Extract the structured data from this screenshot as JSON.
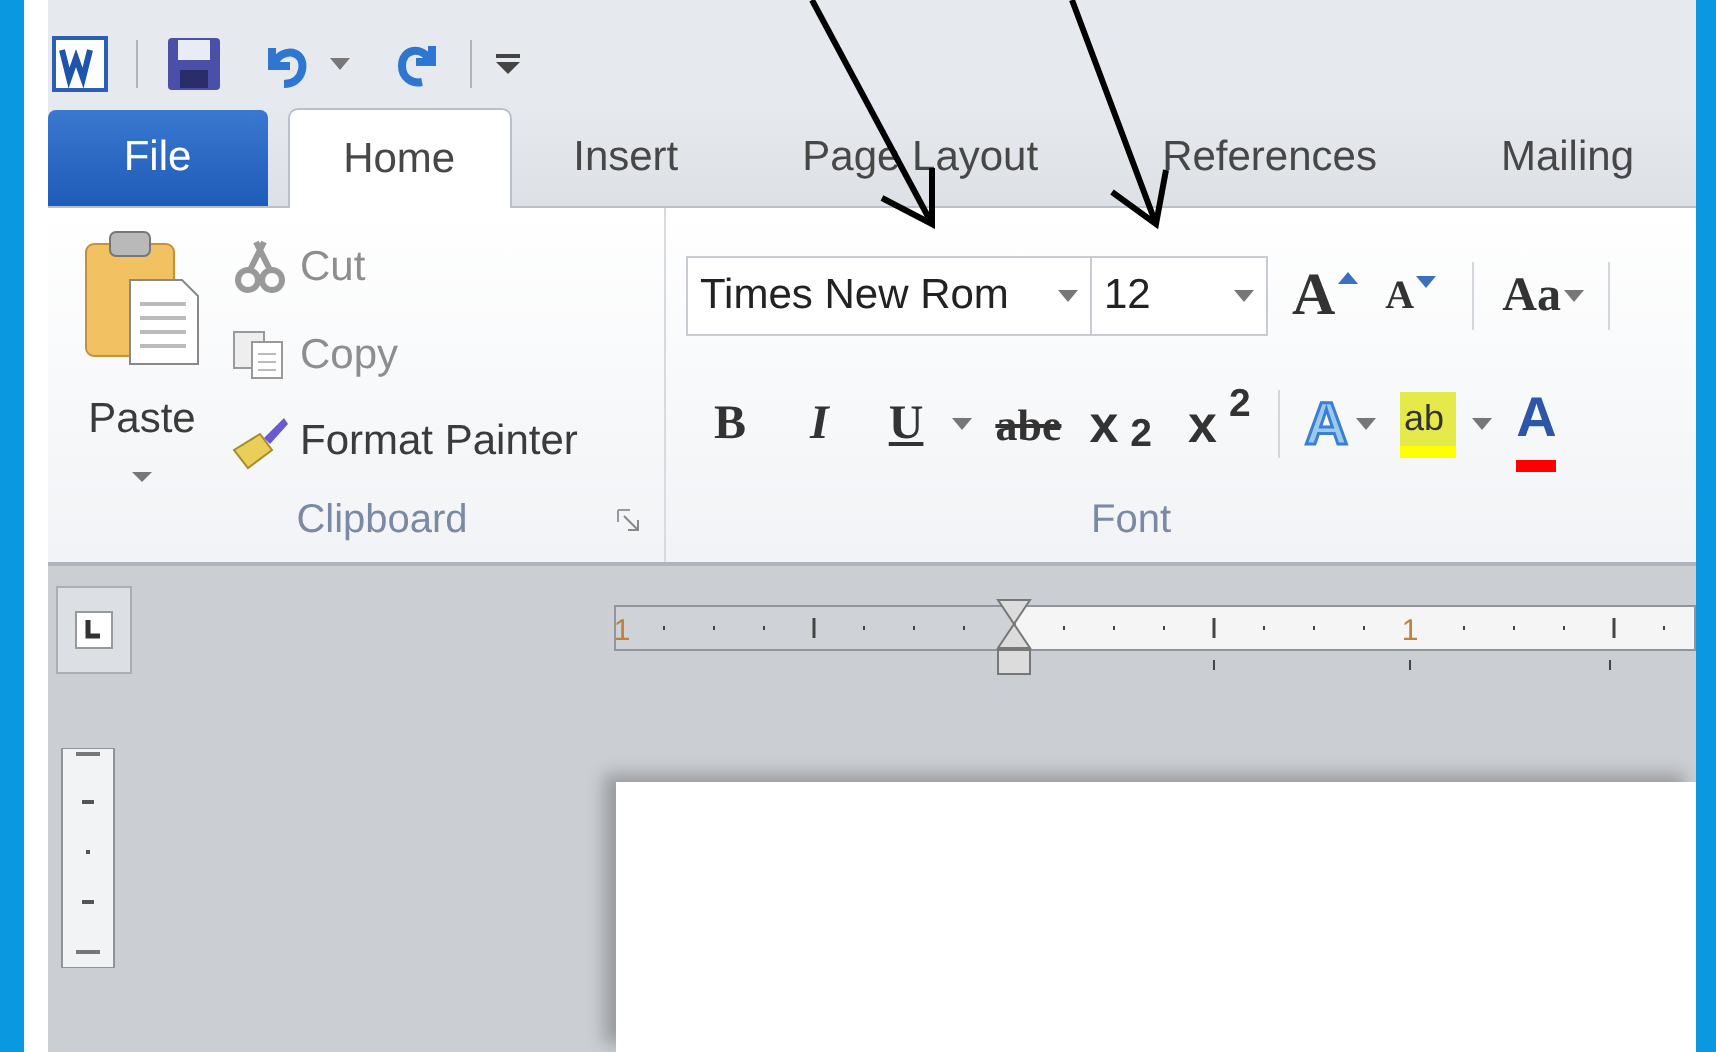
{
  "tabs": [
    {
      "label": "File",
      "kind": "file",
      "selected": false
    },
    {
      "label": "Home",
      "kind": "tab",
      "selected": true
    },
    {
      "label": "Insert",
      "kind": "tab",
      "selected": false
    },
    {
      "label": "Page Layout",
      "kind": "tab",
      "selected": false
    },
    {
      "label": "References",
      "kind": "tab",
      "selected": false
    },
    {
      "label": "Mailing",
      "kind": "tab",
      "selected": false
    }
  ],
  "clipboard": {
    "paste": "Paste",
    "items": [
      {
        "label": "Cut",
        "kind": "scissors",
        "disabled": true
      },
      {
        "label": "Copy",
        "kind": "copy",
        "disabled": true
      },
      {
        "label": "Format Painter",
        "kind": "brush",
        "disabled": false
      }
    ],
    "group_label": "Clipboard"
  },
  "font": {
    "font_name": "Times New Rom",
    "font_size": "12",
    "grow": "A",
    "shrink": "A",
    "change_case": "Aa",
    "bold": "B",
    "italic": "I",
    "underline": "U",
    "strikethrough": "abe",
    "subscript": "x$_{2}$",
    "superscript": "x$^{2}$",
    "text_effects": "A",
    "highlight": "ab",
    "font_color": "A",
    "group_label": "Font"
  },
  "ruler": {
    "labels": [
      "1",
      "1"
    ]
  }
}
